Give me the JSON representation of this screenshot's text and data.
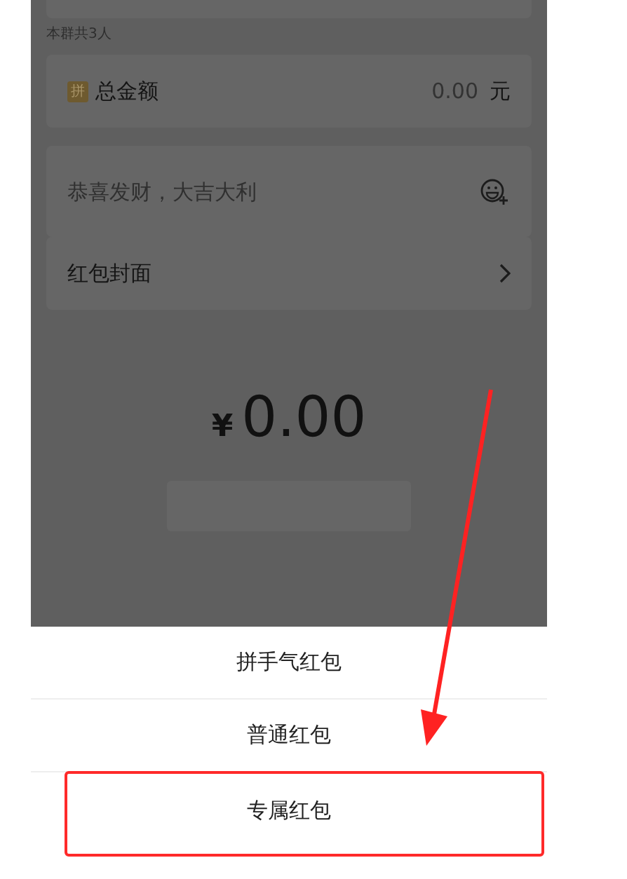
{
  "group_info": "本群共3人",
  "amount_row": {
    "badge": "拼",
    "label": "总金额",
    "value": "0.00",
    "unit": "元"
  },
  "greeting_field": {
    "placeholder": "恭喜发财，大吉大利"
  },
  "cover_row": {
    "label": "红包封面"
  },
  "total": {
    "currency": "¥",
    "amount": "0.00"
  },
  "action_sheet": {
    "options": [
      {
        "label": "拼手气红包",
        "highlighted": false
      },
      {
        "label": "普通红包",
        "highlighted": false
      },
      {
        "label": "专属红包",
        "highlighted": true
      }
    ]
  }
}
